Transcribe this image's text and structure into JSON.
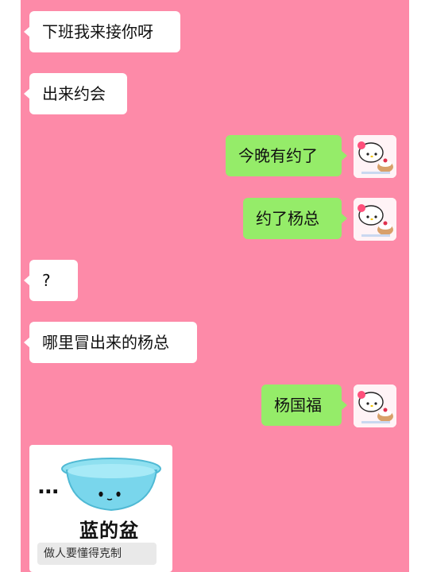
{
  "colors": {
    "background": "#fd8aa8",
    "incoming_bubble": "#ffffff",
    "outgoing_bubble": "#95ec69"
  },
  "messages": [
    {
      "side": "left",
      "text": "下班我来接你呀"
    },
    {
      "side": "left",
      "text": "出来约会"
    },
    {
      "side": "right",
      "text": "今晚有约了",
      "avatar": "hello-kitty-avatar"
    },
    {
      "side": "right",
      "text": "约了杨总",
      "avatar": "hello-kitty-avatar"
    },
    {
      "side": "left",
      "text": "?"
    },
    {
      "side": "left",
      "text": "哪里冒出来的杨总"
    },
    {
      "side": "right",
      "text": "杨国福",
      "avatar": "hello-kitty-avatar"
    }
  ],
  "sticker": {
    "dots": "...",
    "title": "蓝的盆",
    "caption": "做人要懂得克制",
    "icon": "blue-basin-icon"
  }
}
